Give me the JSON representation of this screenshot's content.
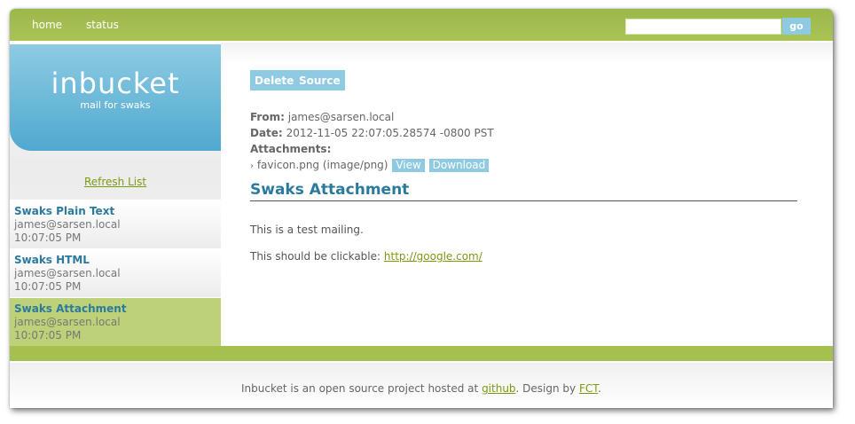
{
  "nav": {
    "home": "home",
    "status": "status"
  },
  "search": {
    "value": "",
    "placeholder": "",
    "go_label": "go"
  },
  "logo": {
    "title": "inbucket",
    "subtitle": "mail for swaks"
  },
  "sidebar": {
    "refresh_label": "Refresh List",
    "messages": [
      {
        "subject": "Swaks Plain Text",
        "from": "james@sarsen.local",
        "time": "10:07:05 PM",
        "selected": false
      },
      {
        "subject": "Swaks HTML",
        "from": "james@sarsen.local",
        "time": "10:07:05 PM",
        "selected": false
      },
      {
        "subject": "Swaks Attachment",
        "from": "james@sarsen.local",
        "time": "10:07:05 PM",
        "selected": true
      }
    ]
  },
  "message": {
    "delete_label": "Delete",
    "source_label": "Source",
    "from_label": "From:",
    "from_value": "james@sarsen.local",
    "date_label": "Date:",
    "date_value": "2012-11-05 22:07:05.28574 -0800 PST",
    "attachments_label": "Attachments:",
    "attachment": {
      "bullet": "›",
      "name": "favicon.png (image/png)",
      "view_label": "View",
      "download_label": "Download"
    },
    "subject": "Swaks Attachment",
    "body_line1": "This is a test mailing.",
    "body_line2_prefix": "This should be clickable:",
    "body_link": "http://google.com/"
  },
  "footer": {
    "text_before": "Inbucket is an open source project hosted at",
    "github_link": "github",
    "text_middle": ". Design by",
    "fct_link": "FCT",
    "text_after": "."
  },
  "colors": {
    "topbar_green": "#a4c14f",
    "logo_blue": "#4fa9cf",
    "button_blue": "#8ecae2",
    "link_green": "#7a9a10",
    "subject_blue": "#2b7a9e",
    "selected_row": "#bdd278"
  }
}
